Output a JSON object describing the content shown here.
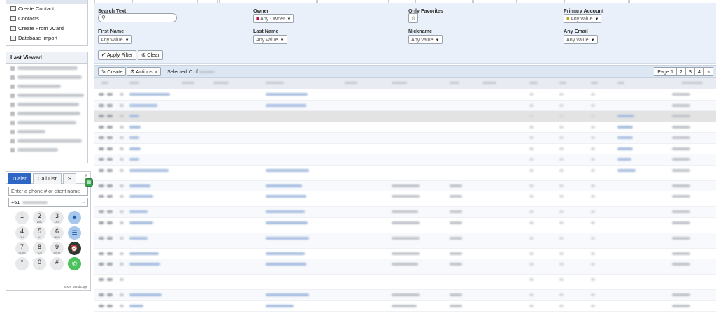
{
  "shortcuts": {
    "items": [
      {
        "label": "Create Contact",
        "icon": "contact-card-icon"
      },
      {
        "label": "Contacts",
        "icon": "contact-list-icon"
      },
      {
        "label": "Create From vCard",
        "icon": "vcard-icon"
      },
      {
        "label": "Database Import",
        "icon": "import-icon"
      }
    ]
  },
  "last_viewed": {
    "title": "Last Viewed"
  },
  "dialer": {
    "tabs": [
      "Dialer",
      "Call List",
      "S"
    ],
    "close": "x",
    "phone_placeholder": "Enter a phone # or client name",
    "country_code": "+61",
    "keys": [
      {
        "digit": "1",
        "sub": ""
      },
      {
        "digit": "2",
        "sub": "ABC"
      },
      {
        "digit": "3",
        "sub": "DEF"
      },
      {
        "digit": "4",
        "sub": "GHI"
      },
      {
        "digit": "5",
        "sub": "JKL"
      },
      {
        "digit": "6",
        "sub": "MNO"
      },
      {
        "digit": "7",
        "sub": "PQRS"
      },
      {
        "digit": "8",
        "sub": "TUV"
      },
      {
        "digit": "9",
        "sub": "WXYZ"
      },
      {
        "digit": "*",
        "sub": ""
      },
      {
        "digit": "0",
        "sub": "+"
      },
      {
        "digit": "#",
        "sub": ""
      }
    ],
    "footer": "EXIF  Send Logs"
  },
  "filters": {
    "search_text_label": "Search Text",
    "owner_label": "Owner",
    "owner_value": "Any Owner",
    "only_favorites_label": "Only Favorites",
    "primary_account_label": "Primary Account",
    "primary_account_value": "Any value",
    "first_name_label": "First Name",
    "first_name_value": "Any value",
    "last_name_label": "Last Name",
    "last_name_value": "Any value",
    "nickname_label": "Nickname",
    "nickname_value": "Any value",
    "any_email_label": "Any Email",
    "any_email_value": "Any value",
    "apply_filter": "Apply Filter",
    "clear": "Clear"
  },
  "toolbar": {
    "create": "Create",
    "actions": "Actions",
    "selected_text": "Selected: 0 of",
    "pages": [
      "Page 1",
      "2",
      "3",
      "4",
      "»"
    ]
  },
  "colors": {
    "accent": "#2f66c3",
    "filter_bg": "#e9f0f9",
    "toolbar_bg": "#dde7f4",
    "call_green": "#4cc25d"
  }
}
